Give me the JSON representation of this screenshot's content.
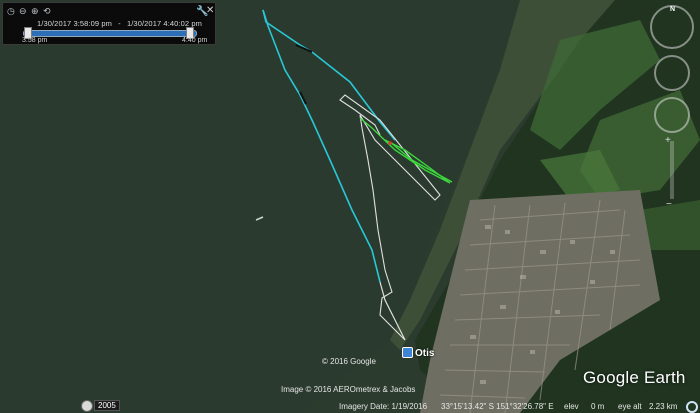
{
  "time_slider": {
    "range_start": "1/30/2017   3:58:09 pm",
    "range_end": "1/30/2017   4:40:02 pm",
    "start_label": "3:58 pm",
    "end_label": "4:40 pm"
  },
  "map": {
    "copyright_2016": "© 2016 Google",
    "attribution": "Image © 2016 AEROmetrex & Jacobs",
    "place_label": "Otis",
    "logo": "Google Earth",
    "track_colors": {
      "cyan": "#28c8d6",
      "white": "#e0e0e0",
      "green": "#3dd73d"
    }
  },
  "status_bar": {
    "history_year": "2005",
    "imagery_date": "Imagery Date: 1/19/2016",
    "coords": "33°15'13.42\" S  151°32'26.78\" E",
    "elev_label": "elev",
    "elev_value": "0 m",
    "eye_alt_label": "eye alt",
    "eye_alt_value": "2.23 km"
  },
  "icons": {
    "time_back": "◷",
    "zoom_out": "⊖",
    "zoom_in": "⊕",
    "history": "⟲",
    "wrench": "🔧",
    "close": "✕",
    "compass_n": "N",
    "plus": "+",
    "minus": "−"
  }
}
